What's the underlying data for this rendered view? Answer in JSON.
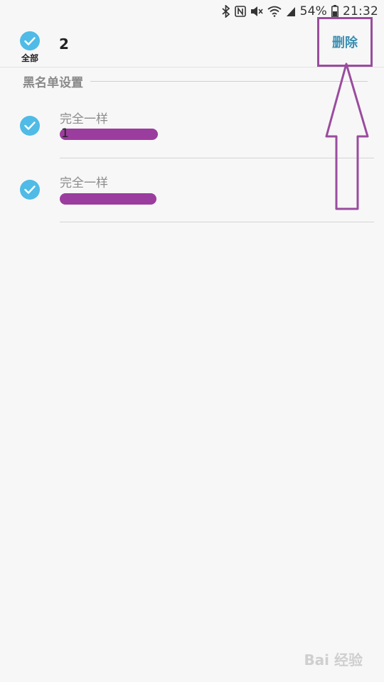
{
  "status_bar": {
    "battery": "54%",
    "time": "21:32",
    "icons": [
      "bluetooth-icon",
      "nfc-icon",
      "mute-icon",
      "wifi-icon",
      "signal-icon",
      "battery-icon"
    ]
  },
  "header": {
    "select_all_label": "全部",
    "selected_count": "2",
    "delete_label": "删除"
  },
  "section": {
    "title": "黑名单设置"
  },
  "items": [
    {
      "title": "完全一样",
      "number": "1",
      "checked": true
    },
    {
      "title": "完全一样",
      "number": "",
      "checked": true
    }
  ],
  "colors": {
    "accent": "#4fbbe6",
    "delete_text": "#3a8fb3",
    "annotation": "#9a4c9e",
    "redaction": "#9b3d9e"
  },
  "watermark": "Bai 经验"
}
